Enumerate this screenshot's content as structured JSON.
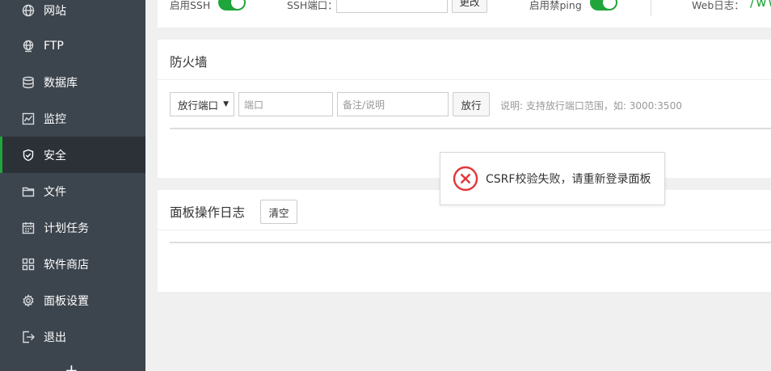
{
  "sidebar": {
    "items": [
      {
        "label": "网站",
        "icon": "globe-icon"
      },
      {
        "label": "FTP",
        "icon": "ftp-globe-icon"
      },
      {
        "label": "数据库",
        "icon": "database-icon"
      },
      {
        "label": "监控",
        "icon": "monitor-icon"
      },
      {
        "label": "安全",
        "icon": "shield-check-icon",
        "active": true
      },
      {
        "label": "文件",
        "icon": "folder-icon"
      },
      {
        "label": "计划任务",
        "icon": "calendar-icon"
      },
      {
        "label": "软件商店",
        "icon": "grid-icon"
      },
      {
        "label": "面板设置",
        "icon": "gear-icon"
      },
      {
        "label": "退出",
        "icon": "logout-icon"
      }
    ],
    "add_symbol": "+"
  },
  "top_row": {
    "ssh_label": "启用SSH",
    "ssh_port_label": "SSH端口：",
    "ssh_port_value": "",
    "change_button": "更改",
    "ping_label": "启用禁ping",
    "weblog_label": "Web日志：",
    "weblog_value": "/ww"
  },
  "firewall": {
    "title": "防火墙",
    "select_value": "放行端口",
    "port_placeholder": "端口",
    "note_placeholder": "备注/说明",
    "allow_button": "放行",
    "hint": "说明: 支持放行端口范围，如: 3000:3500"
  },
  "log": {
    "title": "面板操作日志",
    "clear_button": "清空"
  },
  "toast": {
    "message": "CSRF校验失败，请重新登录面板"
  },
  "colors": {
    "sidebar_bg": "#3c444d",
    "active_bg": "#2c3138",
    "accent": "#20a53a",
    "error": "#e0373a"
  }
}
